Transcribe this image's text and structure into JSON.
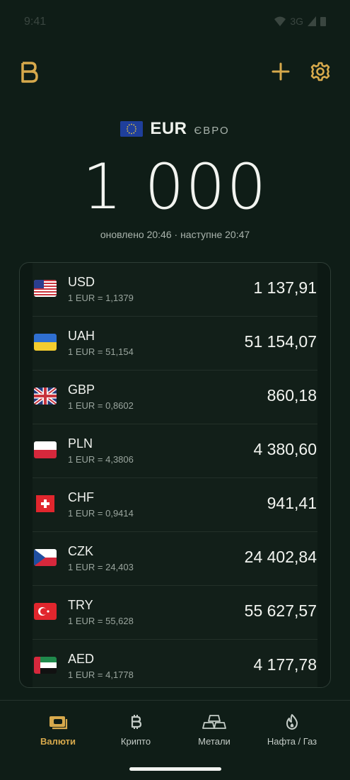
{
  "status_bar": {
    "time": "9:41",
    "network": "3G"
  },
  "colors": {
    "accent": "#d7a94c",
    "background": "#0f1d17"
  },
  "icons": {
    "logo": "b-logo-icon",
    "add": "plus-icon",
    "settings": "gear-icon"
  },
  "base": {
    "code": "EUR",
    "name": "ЄВРО",
    "amount": "1 000",
    "updated": "оновлено 20:46 · наступне 20:47"
  },
  "rates": [
    {
      "code": "USD",
      "rate": "1 EUR = 1,1379",
      "value": "1 137,91"
    },
    {
      "code": "UAH",
      "rate": "1 EUR = 51,154",
      "value": "51 154,07"
    },
    {
      "code": "GBP",
      "rate": "1 EUR = 0,8602",
      "value": "860,18"
    },
    {
      "code": "PLN",
      "rate": "1 EUR = 4,3806",
      "value": "4 380,60"
    },
    {
      "code": "CHF",
      "rate": "1 EUR = 0,9414",
      "value": "941,41"
    },
    {
      "code": "CZK",
      "rate": "1 EUR = 24,403",
      "value": "24 402,84"
    },
    {
      "code": "TRY",
      "rate": "1 EUR = 55,628",
      "value": "55 627,57"
    },
    {
      "code": "AED",
      "rate": "1 EUR = 4,1778",
      "value": "4 177,78"
    }
  ],
  "tabs": [
    {
      "label": "Валюти",
      "icon": "banknote-icon",
      "active": true
    },
    {
      "label": "Крипто",
      "icon": "bitcoin-icon",
      "active": false
    },
    {
      "label": "Метали",
      "icon": "gold-bars-icon",
      "active": false
    },
    {
      "label": "Нафта / Газ",
      "icon": "flame-icon",
      "active": false
    }
  ]
}
